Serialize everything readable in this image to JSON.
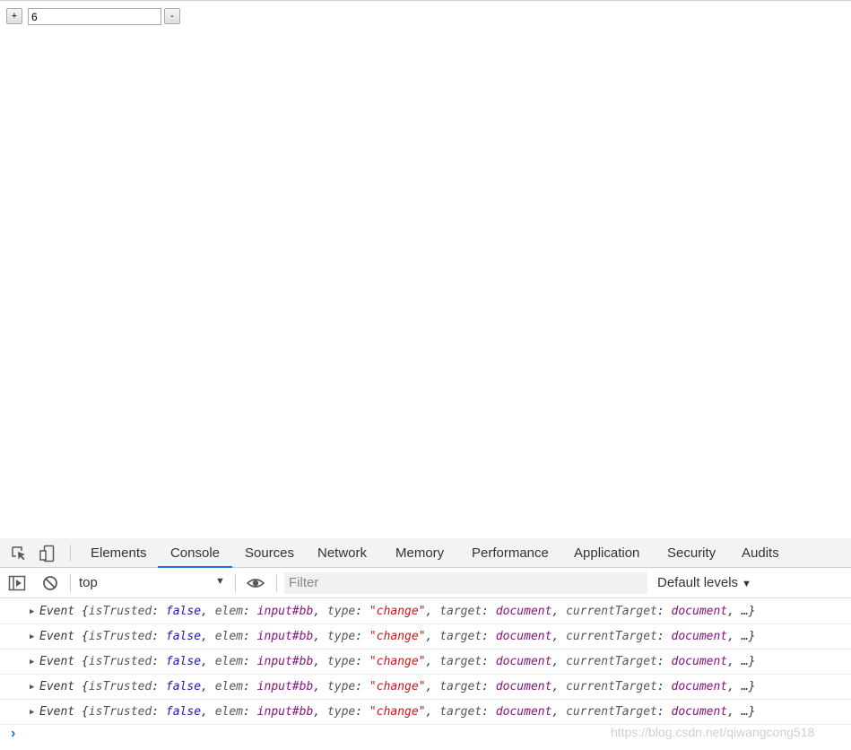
{
  "page": {
    "plus_label": "+",
    "value": "6",
    "minus_label": "-"
  },
  "devtools": {
    "icons": [
      "inspect-element-icon",
      "device-toolbar-icon"
    ],
    "tabs": [
      {
        "label": "Elements",
        "active": false
      },
      {
        "label": "Console",
        "active": true
      },
      {
        "label": "Sources",
        "active": false
      },
      {
        "label": "Network",
        "active": false
      },
      {
        "label": "Memory",
        "active": false
      },
      {
        "label": "Performance",
        "active": false
      },
      {
        "label": "Application",
        "active": false
      },
      {
        "label": "Security",
        "active": false
      },
      {
        "label": "Audits",
        "active": false
      }
    ],
    "toolbar": {
      "context": "top",
      "filter_placeholder": "Filter",
      "levels": "Default levels"
    },
    "log_entry": {
      "class_name": "Event",
      "props": [
        {
          "key": "isTrusted",
          "value": "false",
          "kind": "bool"
        },
        {
          "key": "elem",
          "value": "input#bb",
          "kind": "node"
        },
        {
          "key": "type",
          "value": "\"change\"",
          "kind": "str"
        },
        {
          "key": "target",
          "value": "document",
          "kind": "node"
        },
        {
          "key": "currentTarget",
          "value": "document",
          "kind": "node"
        }
      ],
      "tail": "…}"
    },
    "log_count": 5,
    "prompt_symbol": "›"
  },
  "watermark": "https://blog.csdn.net/qiwangcong518",
  "colors": {
    "accent": "#1a73e8",
    "bool": "#1a1aa6",
    "node": "#881280",
    "string": "#c41a16"
  }
}
